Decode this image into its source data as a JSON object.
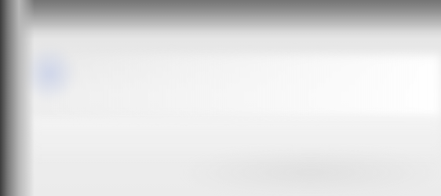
{
  "screen": {
    "state": "blurred",
    "colors": {
      "background": "#ebebeb",
      "top_shade": "#8a8a8a",
      "left_edge": "#3c3c3c",
      "tint": "#c8d0e8"
    }
  }
}
